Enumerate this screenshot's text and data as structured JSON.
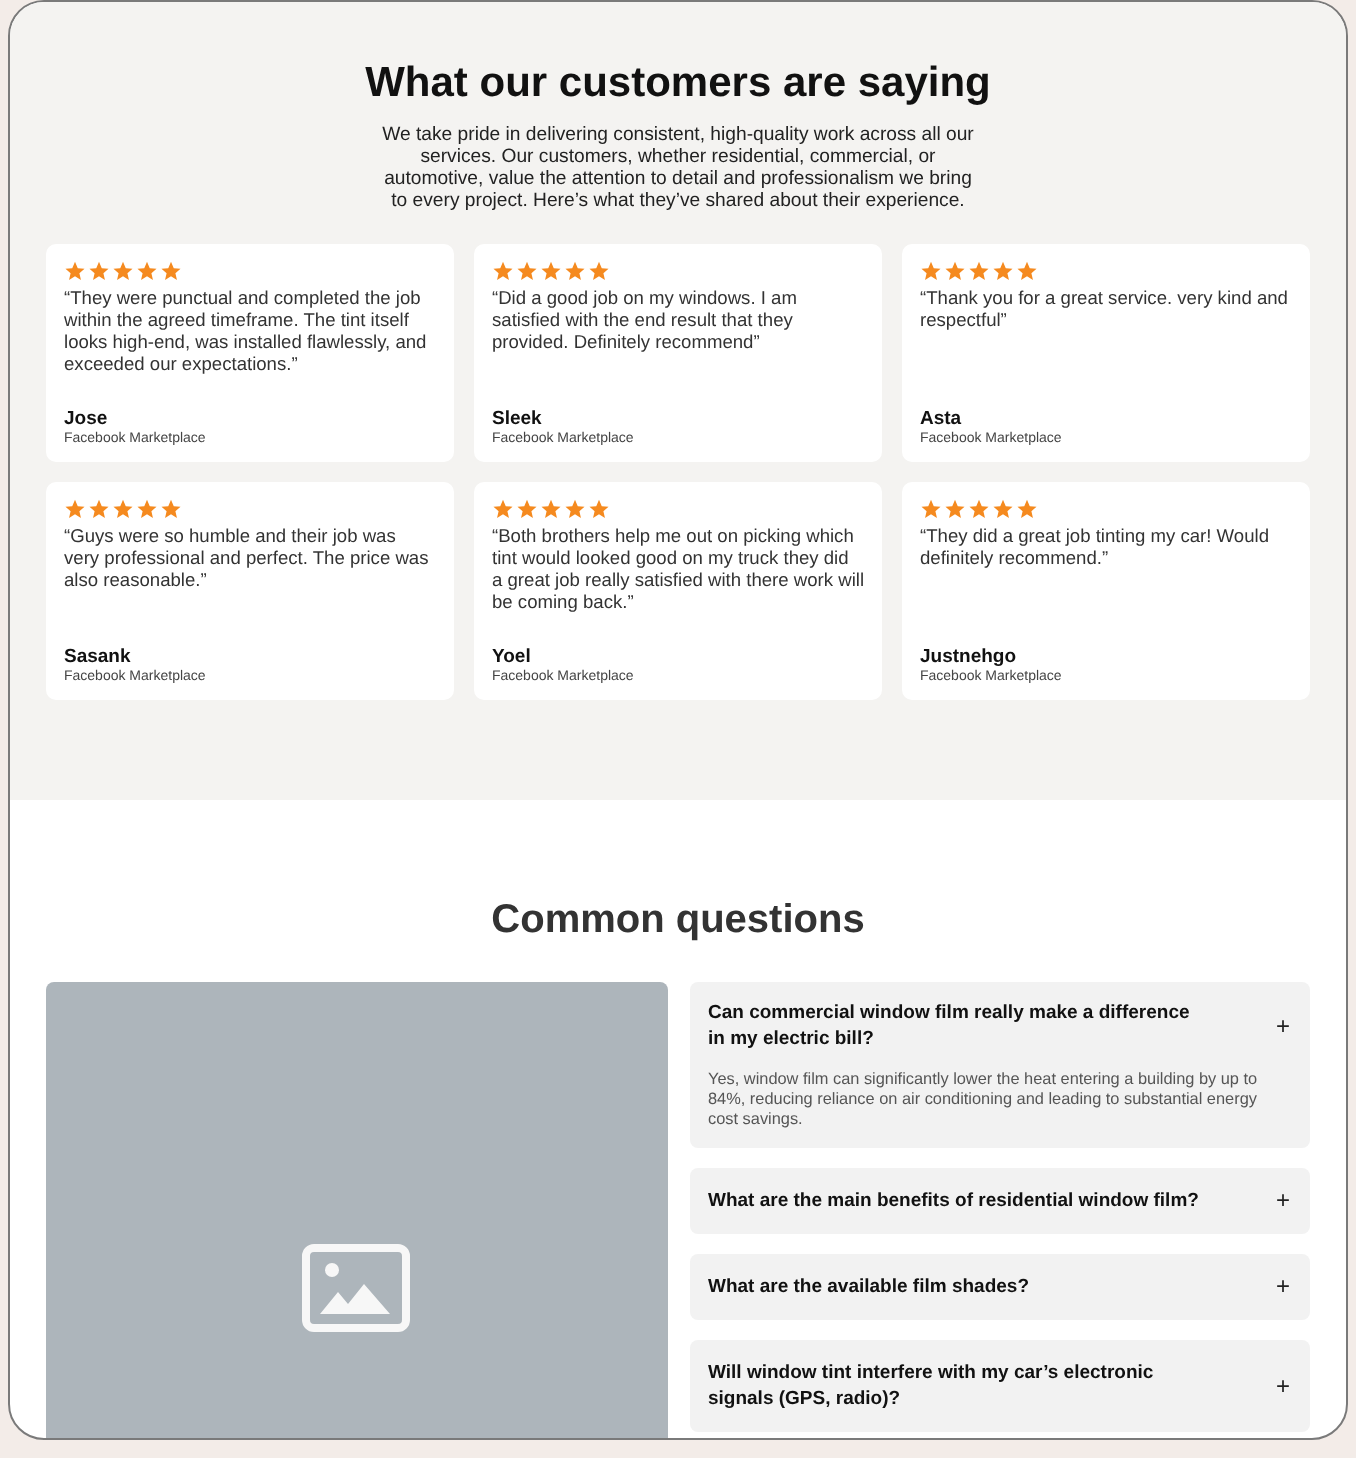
{
  "testimonials": {
    "title": "What our customers are saying",
    "intro": "We take pride in delivering consistent, high-quality work across all our services. Our customers, whether residential, commercial, or automotive, value the attention to detail and professionalism we bring to every project. Here’s what they’ve shared about their experience.",
    "reviews": [
      {
        "stars": 5,
        "quote": "“They were punctual and completed the job within the agreed timeframe. The tint itself looks high-end, was installed flawlessly, and exceeded our expectations.”",
        "name": "Jose",
        "source": "Facebook Marketplace"
      },
      {
        "stars": 5,
        "quote": "“Did a good job on my windows. I am satisfied with the end result that they provided. Definitely recommend”",
        "name": "Sleek",
        "source": "Facebook Marketplace"
      },
      {
        "stars": 5,
        "quote": "“Thank you for a great service. very kind and respectful”",
        "name": "Asta",
        "source": "Facebook Marketplace"
      },
      {
        "stars": 5,
        "quote": "“Guys were so humble and their job was very professional and perfect. The price was also reasonable.”",
        "name": "Sasank",
        "source": "Facebook Marketplace"
      },
      {
        "stars": 5,
        "quote": "“Both brothers help me out on picking which tint would looked good on my truck they did a great job really satisfied with there work will be coming back.”",
        "name": "Yoel",
        "source": "Facebook Marketplace"
      },
      {
        "stars": 5,
        "quote": "“They did a great job tinting my car! Would definitely recommend.”",
        "name": "Justnehgo",
        "source": "Facebook Marketplace"
      }
    ]
  },
  "faq": {
    "title": "Common questions",
    "items": [
      {
        "question": "Can commercial window film really make a difference in my electric bill?",
        "expanded": true,
        "answer": "Yes, window film can significantly lower the heat entering a building by up to 84%, reducing reliance on air conditioning and leading to substantial energy cost savings.",
        "toggle": "+"
      },
      {
        "question": "What are the main benefits of residential window film?",
        "expanded": false,
        "toggle": "+"
      },
      {
        "question": "What are the available film shades?",
        "expanded": false,
        "toggle": "+"
      },
      {
        "question": "Will window tint interfere with my car’s electronic signals (GPS, radio)?",
        "expanded": false,
        "toggle": "+"
      }
    ]
  }
}
